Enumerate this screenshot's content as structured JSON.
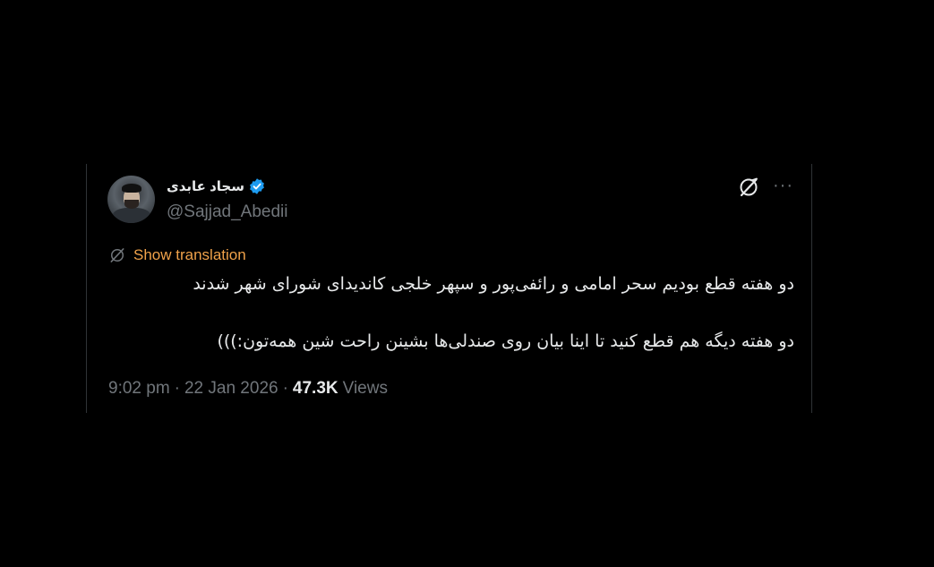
{
  "tweet": {
    "display_name": "سجاد عابدی",
    "handle": "@Sajjad_Abedii",
    "translate_label": "Show translation",
    "text_line_1": "دو هفته قطع بودیم سحر امامی و رائفی‌پور و سپهر خلجی کاندیدای شورای شهر شدند",
    "text_line_2": "دو هفته دیگه هم قطع کنید تا اینا بیان روی صندلی‌ها بشینن راحت شین همه‌تون:)))",
    "time": "9:02 pm",
    "separator_1": "·",
    "date": "22 Jan 2026",
    "separator_2": "·",
    "views_count": "47.3K",
    "views_label": "Views"
  },
  "icons": {
    "verified": "verified-badge-icon",
    "grok": "grok-icon",
    "more": "more-options-icon",
    "translate": "translate-icon"
  },
  "colors": {
    "background": "#000000",
    "text_primary": "#e7e9ea",
    "text_secondary": "#71767b",
    "verified_blue": "#1d9bf0",
    "translate_orange": "#f0a24a"
  }
}
